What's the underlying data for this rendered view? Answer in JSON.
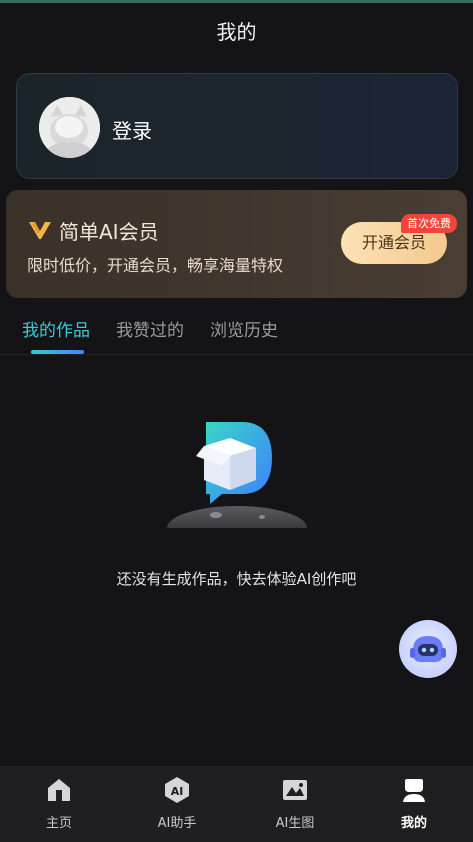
{
  "header": {
    "title": "我的"
  },
  "login": {
    "label": "登录"
  },
  "vip": {
    "title": "简单AI会员",
    "subtitle": "限时低价，开通会员，畅享海量特权",
    "button": "开通会员",
    "badge": "首次免费"
  },
  "tabs": [
    {
      "label": "我的作品",
      "active": true
    },
    {
      "label": "我赞过的",
      "active": false
    },
    {
      "label": "浏览历史",
      "active": false
    }
  ],
  "empty": {
    "message": "还没有生成作品，快去体验AI创作吧"
  },
  "bottom_nav": [
    {
      "label": "主页",
      "icon": "home-icon"
    },
    {
      "label": "AI助手",
      "icon": "ai-assistant-icon",
      "icon_text": "AI"
    },
    {
      "label": "AI生图",
      "icon": "image-gen-icon"
    },
    {
      "label": "我的",
      "icon": "profile-icon",
      "active": true
    }
  ],
  "colors": {
    "accent": "#3cc8d8",
    "vip_gold": "#f4c98f",
    "badge_red": "#f0453a",
    "background": "#141416"
  }
}
